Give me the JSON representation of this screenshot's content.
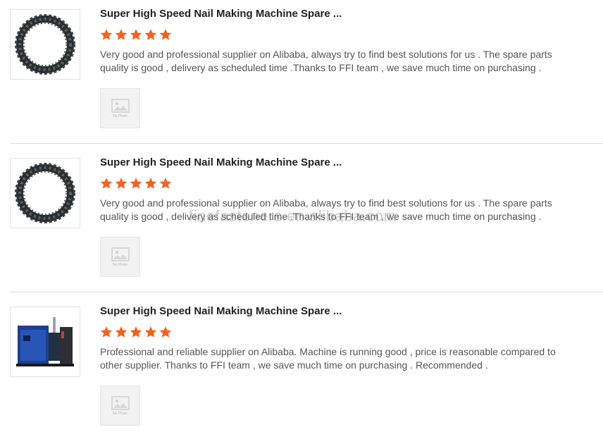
{
  "reviews": [
    {
      "title": "Super High Speed Nail Making Machine Spare ...",
      "rating": 5,
      "text": "Very good and professional supplier on Alibaba, always try to find best solutions for  us . The spare parts quality is good , delivery as scheduled time .Thanks to FFI team , we save much time on purchasing .",
      "thumbnail": "chain-ring-photo",
      "attachment_label": "No Photo"
    },
    {
      "title": "Super High Speed Nail Making Machine Spare ...",
      "rating": 5,
      "text": "Very good and professional supplier on Alibaba, always try to find best solutions for  us . The spare parts quality is good , delivery as scheduled time .Thanks to FFI team , we save much time on purchasing .",
      "thumbnail": "chain-ring-photo",
      "attachment_label": "No Photo"
    },
    {
      "title": "Super High Speed Nail Making Machine Spare ...",
      "rating": 5,
      "text": "Professional and reliable supplier on Alibaba. Machine is running good , price is reasonable compared to other supplier. Thanks to FFI team , we save much time on purchasing . Recommended .",
      "thumbnail": "blue-machine-photo",
      "attachment_label": "No Photo"
    }
  ],
  "watermark": "finefasteners.en.alibaba.com",
  "colors": {
    "star": "#f4621f",
    "title": "#222222",
    "body_text": "#555555",
    "divider": "#dcdcdc"
  },
  "icons": {
    "star": "star-icon",
    "placeholder": "image-placeholder-icon"
  }
}
